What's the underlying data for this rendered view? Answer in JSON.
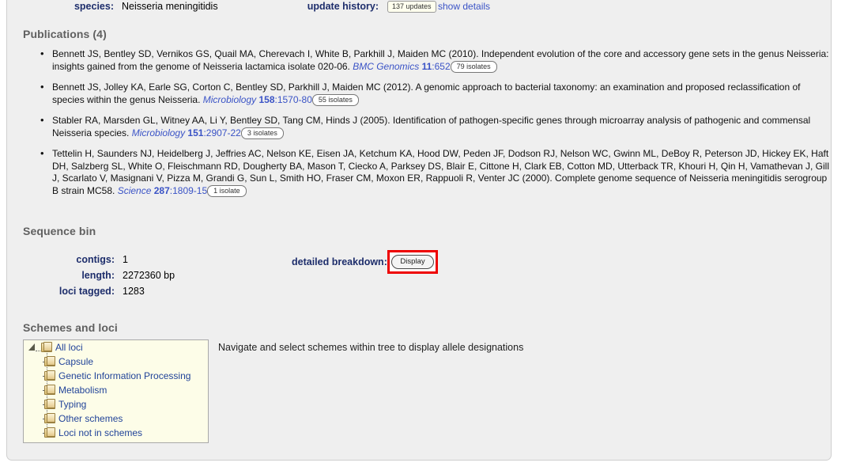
{
  "summary": {
    "species_label": "species:",
    "species_value": "Neisseria meningitidis",
    "update_history_label": "update history:",
    "update_history_badge": "137 updates",
    "show_details_link": "show details"
  },
  "publications": {
    "title": "Publications (4)",
    "items": [
      {
        "authors_and_title": "Bennett JS, Bentley SD, Vernikos GS, Quail MA, Cherevach I, White B, Parkhill J, Maiden MC (2010). Independent evolution of the core and accessory gene sets in the genus Neisseria: insights gained from the genome of Neisseria lactamica isolate 020-06. ",
        "journal": "BMC Genomics",
        "volume": "11",
        "pages": ":652",
        "badge": "79 isolates"
      },
      {
        "authors_and_title": "Bennett JS, Jolley KA, Earle SG, Corton C, Bentley SD, Parkhill J, Maiden MC (2012). A genomic approach to bacterial taxonomy: an examination and proposed reclassification of species within the genus Neisseria. ",
        "journal": "Microbiology",
        "volume": "158",
        "pages": ":1570-80",
        "badge": "55 isolates"
      },
      {
        "authors_and_title": "Stabler RA, Marsden GL, Witney AA, Li Y, Bentley SD, Tang CM, Hinds J (2005). Identification of pathogen-specific genes through microarray analysis of pathogenic and commensal Neisseria species. ",
        "journal": "Microbiology",
        "volume": "151",
        "pages": ":2907-22",
        "badge": "3 isolates"
      },
      {
        "authors_and_title": "Tettelin H, Saunders NJ, Heidelberg J, Jeffries AC, Nelson KE, Eisen JA, Ketchum KA, Hood DW, Peden JF, Dodson RJ, Nelson WC, Gwinn ML, DeBoy R, Peterson JD, Hickey EK, Haft DH, Salzberg SL, White O, Fleischmann RD, Dougherty BA, Mason T, Ciecko A, Parksey DS, Blair E, Cittone H, Clark EB, Cotton MD, Utterback TR, Khouri H, Qin H, Vamathevan J, Gill J, Scarlato V, Masignani V, Pizza M, Grandi G, Sun L, Smith HO, Fraser CM, Moxon ER, Rappuoli R, Venter JC (2000). Complete genome sequence of Neisseria meningitidis serogroup B strain MC58. ",
        "journal": "Science",
        "volume": "287",
        "pages": ":1809-15",
        "badge": "1 isolate"
      }
    ]
  },
  "sequence_bin": {
    "title": "Sequence bin",
    "fields": [
      {
        "key": "contigs:",
        "value": "1"
      },
      {
        "key": "length:",
        "value": "2272360 bp"
      },
      {
        "key": "loci tagged:",
        "value": "1283"
      }
    ],
    "detailed_breakdown_label": "detailed breakdown:",
    "display_button": "Display",
    "highlight_color": "#ee0000"
  },
  "schemes_and_loci": {
    "title": "Schemes and loci",
    "hint": "Navigate and select schemes within tree to display allele designations",
    "tree": {
      "root": "All loci",
      "children": [
        "Capsule",
        "Genetic Information Processing",
        "Metabolism",
        "Typing",
        "Other schemes",
        "Loci not in schemes"
      ]
    }
  }
}
